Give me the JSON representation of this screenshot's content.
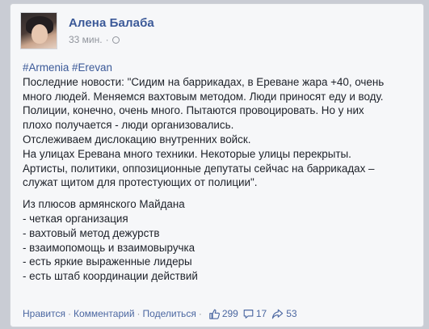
{
  "post": {
    "author": "Алена Балаба",
    "time": "33 мин.",
    "dot": "·",
    "hashtags": [
      "#Armenia",
      "#Erevan"
    ],
    "lines": [
      "Последние новости: \"Сидим на баррикадах, в Ереване жара +40, очень",
      "много людей. Меняемся вахтовым методом. Люди приносят еду и воду.",
      "Полиции, конечно, очень много. Пытаются провоцировать. Но у них",
      "плохо получается - люди организовались.",
      "Отслеживаем дислокацию внутренних войск.",
      "На улицах Еревана много техники. Некоторые улицы перекрыты.",
      "Артисты, политики, оппозиционные депутаты сейчас на баррикадах –",
      "служат щитом для протестующих от полиции\"."
    ],
    "list_intro": "Из плюсов армянского Майдана",
    "list_items": [
      "- четкая организация",
      "- вахтовый метод дежурств",
      "- взаимопомощь и взаимовыручка",
      "- есть яркие выраженные лидеры",
      "- есть штаб координации действий"
    ]
  },
  "actions": {
    "like": "Нравится",
    "comment": "Комментарий",
    "share": "Поделиться",
    "separator": "·",
    "likes_count": "299",
    "comments_count": "17",
    "shares_count": "53"
  },
  "icons": [
    "globe-icon",
    "thumbs-up-icon",
    "comment-icon",
    "share-icon"
  ],
  "colors": {
    "link": "#3b5998",
    "text": "#1d2129",
    "meta": "#90949c"
  }
}
